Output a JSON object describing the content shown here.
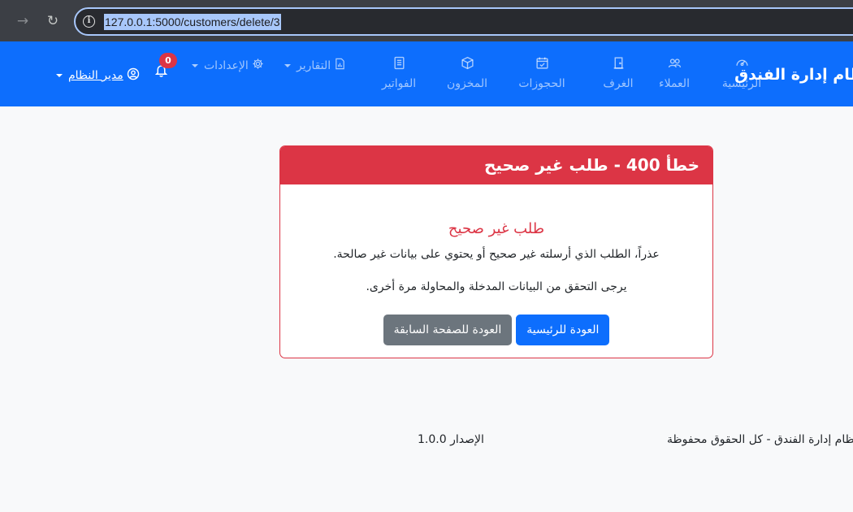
{
  "browser": {
    "url": "127.0.0.1:5000/customers/delete/3"
  },
  "navbar": {
    "brand": "نظام إدارة الفندق",
    "items": [
      {
        "label": "الرئيسية",
        "icon": "dashboard-icon"
      },
      {
        "label": "العملاء",
        "icon": "people-icon"
      },
      {
        "label": "الغرف",
        "icon": "door-icon"
      },
      {
        "label": "الحجوزات",
        "icon": "calendar-check-icon"
      },
      {
        "label": "المخزون",
        "icon": "box-icon"
      },
      {
        "label": "الفواتير",
        "icon": "receipt-icon"
      }
    ],
    "reports_label": "التقارير",
    "settings_label": "الإعدادات",
    "notifications_count": "0",
    "user_label": "مدير النظام"
  },
  "error": {
    "header": "خطأ 400 - طلب غير صحيح",
    "title": "طلب غير صحيح",
    "message": "عذراً، الطلب الذي أرسلته غير صحيح أو يحتوي على بيانات غير صالحة.",
    "hint": "يرجى التحقق من البيانات المدخلة والمحاولة مرة أخرى.",
    "home_button": "العودة للرئيسية",
    "back_button": "العودة للصفحة السابقة"
  },
  "footer": {
    "copyright": "نظام إدارة الفندق - كل الحقوق محفوظة",
    "version": "الإصدار 1.0.0"
  },
  "colors": {
    "primary": "#0d6efd",
    "danger": "#dc3545",
    "secondary": "#6c757d"
  }
}
